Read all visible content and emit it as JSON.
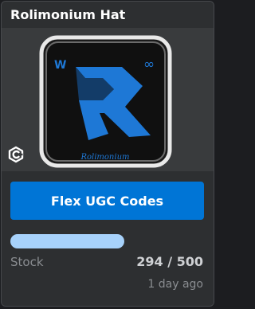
{
  "card": {
    "title": "Rolimonium Hat"
  },
  "thumbnail": {
    "logo_letter": "W",
    "logo_symbol": "∞",
    "logo_text": "Rolimonium",
    "brand_icon": "rolimons-logo-icon",
    "creator_icon": "creator-badge-icon",
    "colors": {
      "frame": "#e9e9e9",
      "background": "#111111",
      "accent": "#1e78d6"
    }
  },
  "actions": {
    "buy_label": "Flex UGC Codes"
  },
  "stock": {
    "label": "Stock",
    "value_text": "294 / 500",
    "remaining": 294,
    "total": 500,
    "fill_fraction": 0.588
  },
  "meta": {
    "timestamp": "1 day ago"
  },
  "colors": {
    "button": "#0075d6",
    "progress_fill": "#a7d2fb",
    "card_header": "#2d2f31",
    "card_image_area": "#393b3d"
  }
}
